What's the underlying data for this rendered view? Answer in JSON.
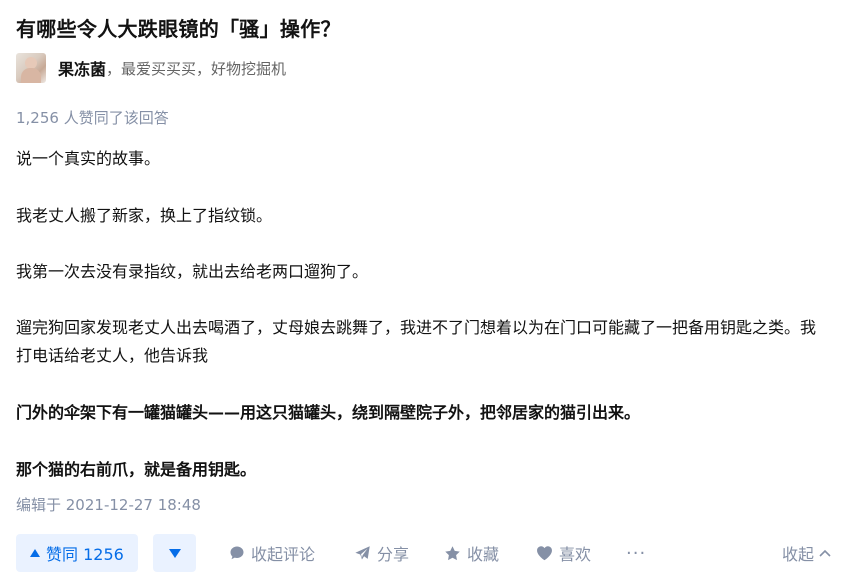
{
  "question": {
    "title": "有哪些令人大跌眼镜的「骚」操作？"
  },
  "author": {
    "name": "果冻菌",
    "bio": "，最爱买买买，好物挖掘机"
  },
  "vote_summary": "1,256 人赞同了该回答",
  "content": {
    "p1": "说一个真实的故事。",
    "p2": "我老丈人搬了新家，换上了指纹锁。",
    "p3": "我第一次去没有录指纹，就出去给老两口遛狗了。",
    "p4": "遛完狗回家发现老丈人出去喝酒了，丈母娘去跳舞了，我进不了门想着以为在门口可能藏了一把备用钥匙之类。我打电话给老丈人，他告诉我",
    "p5": "门外的伞架下有一罐猫罐头——用这只猫罐头，绕到隔壁院子外，把邻居家的猫引出来。",
    "p6": "那个猫的右前爪，就是备用钥匙。"
  },
  "edit_time": "编辑于 2021-12-27 18:48",
  "actions": {
    "vote_up": "赞同 1256",
    "comment": "收起评论",
    "share": "分享",
    "favorite": "收藏",
    "like": "喜欢",
    "more": "···",
    "collapse": "收起"
  },
  "icons": {
    "vote_up": "triangle-up-icon",
    "vote_down": "triangle-down-icon",
    "comment": "comment-bubble-icon",
    "share": "paper-plane-icon",
    "favorite": "star-icon",
    "like": "heart-icon",
    "collapse": "chevron-up-icon"
  },
  "colors": {
    "accent": "#056de8",
    "accent_bg": "#eaf2ff",
    "muted": "#8590a6",
    "text": "#121212"
  }
}
